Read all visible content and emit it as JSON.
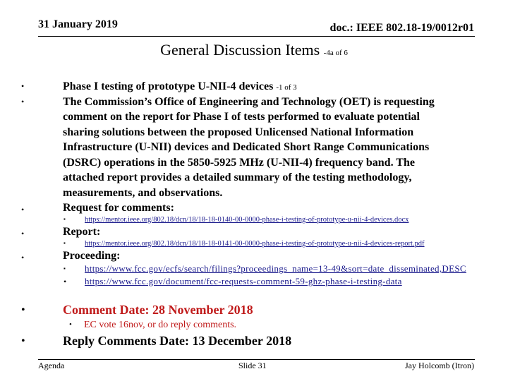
{
  "header": {
    "date": "31 January 2019",
    "doc_id": "doc.: IEEE 802.18-19/0012r01"
  },
  "title": {
    "main": "General Discussion Items",
    "suffix": "-4a of 6"
  },
  "bullets": [
    {
      "text": "Phase I testing of prototype U-NII-4 devices",
      "note": "-1 of 3"
    },
    {
      "lines": [
        "The Commission’s Office of Engineering and Technology (OET) is requesting",
        "comment on the report for Phase I of tests performed to evaluate potential",
        "sharing solutions between the proposed Unlicensed National Information",
        "Infrastructure (U-NII) devices and Dedicated Short Range Communications",
        "(DSRC) operations in the 5850-5925 MHz (U-NII-4) frequency band.  The",
        "attached report provides a detailed summary of the testing methodology,",
        "measurements, and observations."
      ]
    },
    {
      "text": "Request for comments:",
      "link": "https://mentor.ieee.org/802.18/dcn/18/18-18-0140-00-0000-phase-i-testing-of-prototype-u-nii-4-devices.docx"
    },
    {
      "text": "Report:",
      "link": "https://mentor.ieee.org/802.18/dcn/18/18-18-0141-00-0000-phase-i-testing-of-prototype-u-nii-4-devices-report.pdf"
    },
    {
      "text": "Proceeding:",
      "links": [
        "https://www.fcc.gov/ecfs/search/filings?proceedings_name=13-49&sort=date_disseminated,DESC",
        "https://www.fcc.gov/document/fcc-requests-comment-59-ghz-phase-i-testing-data"
      ]
    }
  ],
  "comment_date": {
    "text": "Comment Date:  28 November 2018",
    "note": "EC vote 16nov, or do reply comments."
  },
  "reply_date": {
    "text": "Reply Comments Date:  13 December 2018"
  },
  "footer": {
    "left": "Agenda",
    "center": "Slide 31",
    "right": "Jay Holcomb (Itron)"
  },
  "colors": {
    "link": "#1a1a8c",
    "highlight": "#c01a1a"
  },
  "bullet_glyph": "•",
  "sub_bullet_glyph": "▪"
}
